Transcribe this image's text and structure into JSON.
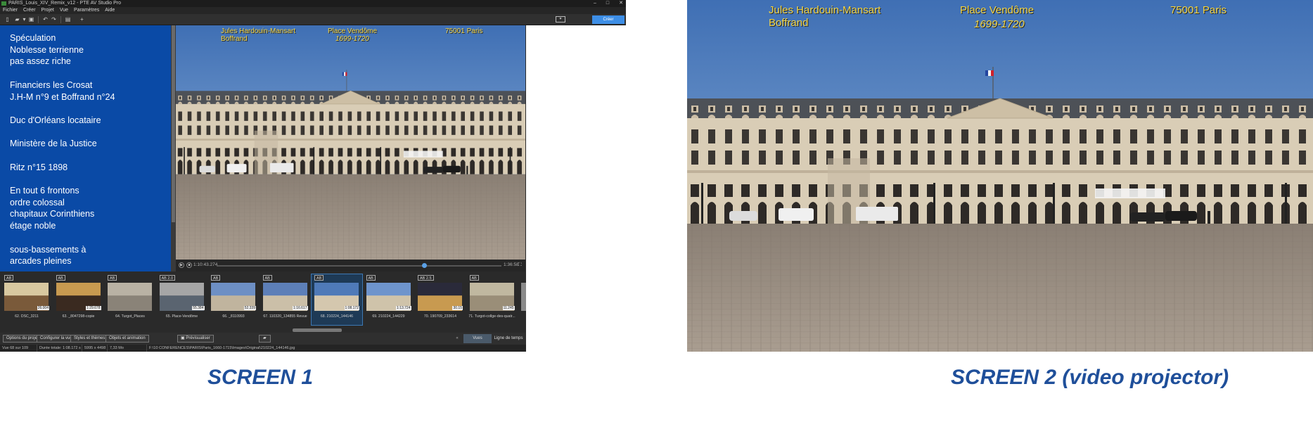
{
  "app": {
    "title": "PARIS_Louis_XIV_Remix_v12 - PTE AV Studio Pro",
    "window_controls": [
      "–",
      "□",
      "✕"
    ],
    "menu": [
      "Fichier",
      "Créer",
      "Projet",
      "Vue",
      "Paramètres",
      "Aide"
    ],
    "toolbar_right_label": "Créer"
  },
  "notes": {
    "lines": [
      "Spéculation",
      "Noblesse terrienne",
      "pas assez riche",
      "",
      "Financiers  les Crosat",
      "J.H-M n°9 et Boffrand n°24",
      "",
      "Duc d'Orléans locataire",
      "",
      "Ministère de la Justice",
      "",
      "Ritz n°15   1898",
      "",
      "En tout 6 frontons",
      "ordre colossal",
      "chapitaux Corinthiens",
      "étage noble",
      "",
      "sous-bassements à",
      "arcades pleines"
    ]
  },
  "overlay": {
    "architects_line1": "Jules Hardouin-Mansart",
    "architects_line2": "Boffrand",
    "place": "Place Vendôme",
    "years": "1699-1720",
    "postcode": "75001 Paris"
  },
  "playback": {
    "current_time": "1:10:43.274",
    "total_time": "1:36:58",
    "progress": 0.729
  },
  "slides": [
    {
      "badge": "AB",
      "label": "62. DSC_3211",
      "duration": "26.004"
    },
    {
      "badge": "AB",
      "label": "63. _8047298-copie",
      "duration": "1:29.678"
    },
    {
      "badge": "AB",
      "label": "64. Turgot_Places",
      "duration": ""
    },
    {
      "badge": "AB 2.0",
      "label": "65. Place-Vendôme",
      "duration": "55.384"
    },
    {
      "badge": "AB",
      "label": "66. _8110993",
      "duration": "52.339"
    },
    {
      "badge": "AB",
      "label": "67. 110320_134855 Revue",
      "duration": "1:16.617"
    },
    {
      "badge": "AB",
      "label": "68. 210224_144146",
      "duration": "1:08.172"
    },
    {
      "badge": "AB",
      "label": "69. 210224_144229",
      "duration": "1:13.724"
    },
    {
      "badge": "AB 2.5",
      "label": "70. 190709_233614",
      "duration": "30.15"
    },
    {
      "badge": "AB",
      "label": "71. Turgot-collge-des-quatr...",
      "duration": "11.245"
    }
  ],
  "selected_slide_index": 6,
  "bottom_buttons": [
    "Options du projet",
    "Configurer la vue",
    "Styles et thèmes",
    "Objets et animation",
    "Prévisualiser"
  ],
  "tabs": [
    "Vues",
    "Ligne de temps"
  ],
  "status": {
    "count": "Vue 68 sur 109",
    "duration": "Durée totale: 1:08.172 s",
    "size": "5995 x 4498",
    "filesize": "7,33 Mo",
    "path": "F:\\10 CONFERENCES\\PARIS\\Paris_1660-1715\\Images\\Original\\210224_144146.jpg"
  },
  "captions": {
    "screen1": "SCREEN 1",
    "screen2": "SCREEN 2 (video projector)"
  },
  "colors": {
    "notes_background": "#0a4aa6",
    "overlay_text": "#f2d64a",
    "caption": "#1f4f9a",
    "accent": "#3d8ee6"
  }
}
